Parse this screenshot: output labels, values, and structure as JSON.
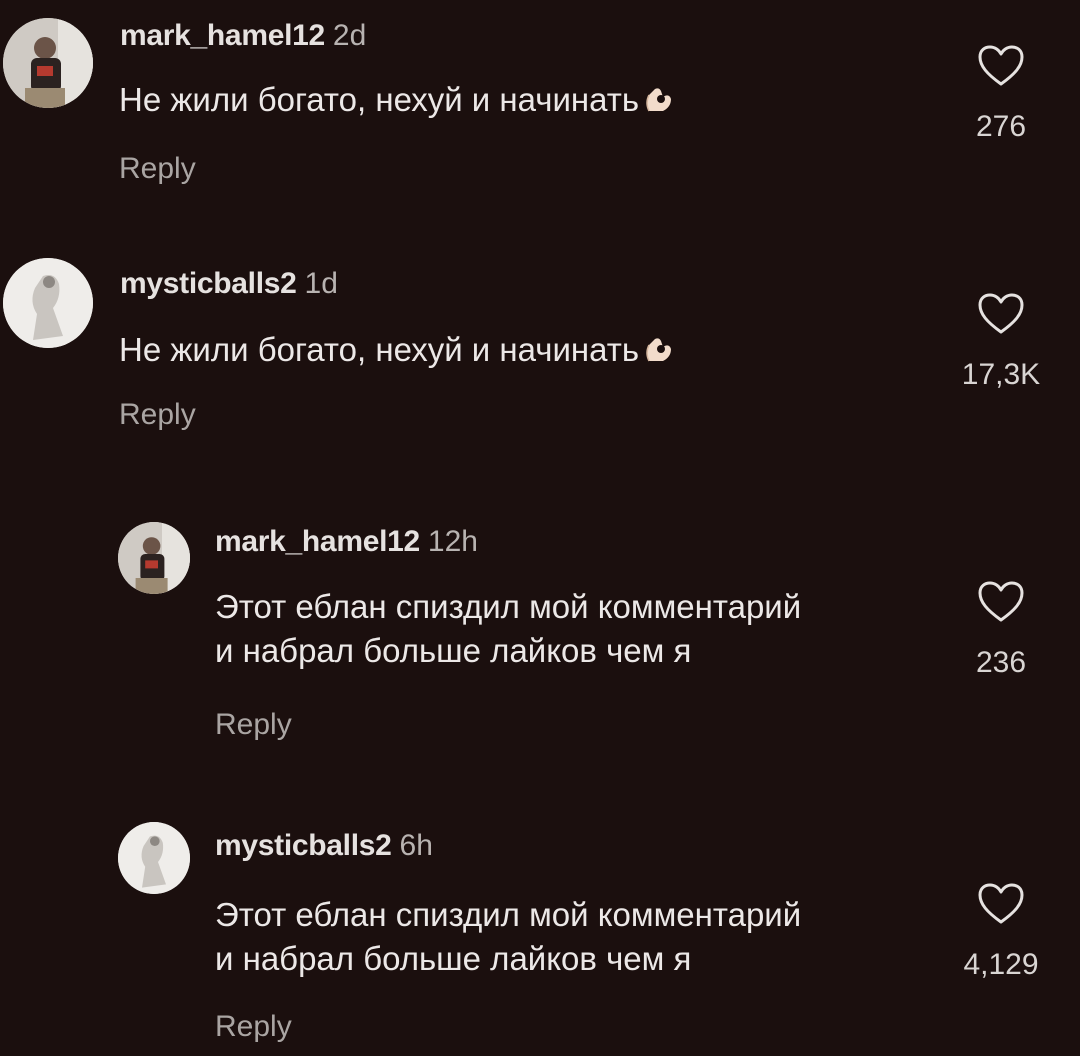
{
  "comments": [
    {
      "username": "mark_hamel12",
      "time": "2d",
      "text": "Не жили богато, нехуй и начинать",
      "emoji": "ok-hand-icon",
      "reply_label": "Reply",
      "likes": "276"
    },
    {
      "username": "mysticballs2",
      "time": "1d",
      "text": "Не жили богато, нехуй и начинать",
      "emoji": "ok-hand-icon",
      "reply_label": "Reply",
      "likes": "17,3K"
    },
    {
      "username": "mark_hamel12",
      "time": "12h",
      "text_line1": "Этот еблан спиздил мой комментарий",
      "text_line2": "и набрал больше лайков чем я",
      "reply_label": "Reply",
      "likes": "236"
    },
    {
      "username": "mysticballs2",
      "time": "6h",
      "text_line1": "Этот еблан спиздил мой комментарий",
      "text_line2": "и набрал больше лайков чем я",
      "reply_label": "Reply",
      "likes": "4,129"
    }
  ],
  "icons": {
    "like": "heart-outline-icon",
    "avatar_mark": "avatar-mirror-selfie",
    "avatar_mystic": "avatar-statue"
  },
  "colors": {
    "background": "#1b0f0e",
    "text": "#ece8e7",
    "muted": "#aaa5a3"
  }
}
